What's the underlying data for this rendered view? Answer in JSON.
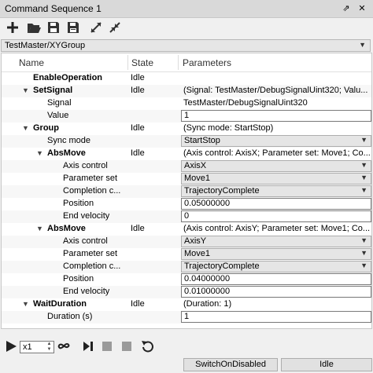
{
  "window": {
    "title": "Command Sequence 1",
    "pin_glyph": "⇗",
    "close_glyph": "✕"
  },
  "toolbar": {
    "icons": [
      "add-icon",
      "open-folder-icon",
      "save-icon",
      "save-as-icon",
      "expand-all-icon",
      "collapse-all-icon"
    ]
  },
  "target_combo": {
    "value": "TestMaster/XYGroup"
  },
  "columns": {
    "name": "Name",
    "state": "State",
    "parameters": "Parameters"
  },
  "rows": [
    {
      "name": "EnableOperation",
      "state": "Idle",
      "param": ""
    },
    {
      "name": "SetSignal",
      "state": "Idle",
      "param": "(Signal: TestMaster/DebugSignalUint320; Valu..."
    },
    {
      "name": "Signal",
      "state": "",
      "param": "TestMaster/DebugSignalUint320"
    },
    {
      "name": "Value",
      "state": "",
      "param": "1"
    },
    {
      "name": "Group",
      "state": "Idle",
      "param": "(Sync mode: StartStop)"
    },
    {
      "name": "Sync mode",
      "state": "",
      "param": "StartStop"
    },
    {
      "name": "AbsMove",
      "state": "Idle",
      "param": "(Axis control: AxisX; Parameter set: Move1; Co..."
    },
    {
      "name": "Axis control",
      "state": "",
      "param": "AxisX"
    },
    {
      "name": "Parameter set",
      "state": "",
      "param": "Move1"
    },
    {
      "name": "Completion c...",
      "state": "",
      "param": "TrajectoryComplete"
    },
    {
      "name": "Position",
      "state": "",
      "param": "0.05000000"
    },
    {
      "name": "End velocity",
      "state": "",
      "param": "0"
    },
    {
      "name": "AbsMove",
      "state": "Idle",
      "param": "(Axis control: AxisY; Parameter set: Move1; Co..."
    },
    {
      "name": "Axis control",
      "state": "",
      "param": "AxisY"
    },
    {
      "name": "Parameter set",
      "state": "",
      "param": "Move1"
    },
    {
      "name": "Completion c...",
      "state": "",
      "param": "TrajectoryComplete"
    },
    {
      "name": "Position",
      "state": "",
      "param": "0.04000000"
    },
    {
      "name": "End velocity",
      "state": "",
      "param": "0.01000000"
    },
    {
      "name": "WaitDuration",
      "state": "Idle",
      "param": "(Duration: 1)"
    },
    {
      "name": "Duration (s)",
      "state": "",
      "param": "1"
    }
  ],
  "player": {
    "speed": "x1"
  },
  "status": {
    "drive_state": "SwitchOnDisabled",
    "sequence_state": "Idle"
  }
}
